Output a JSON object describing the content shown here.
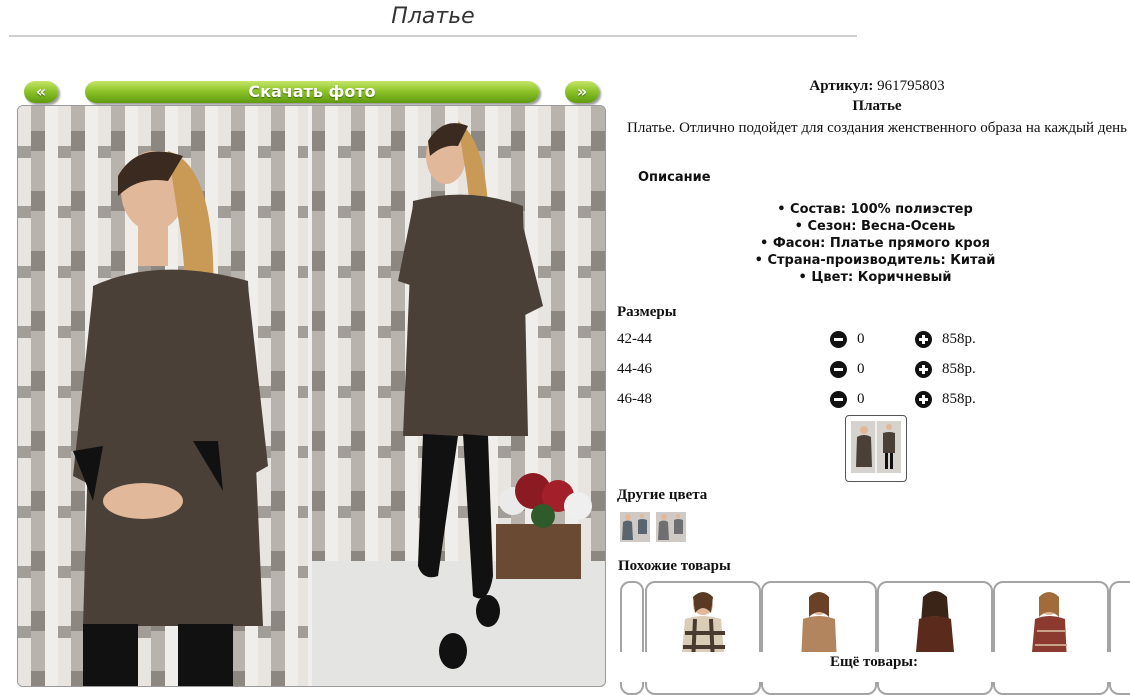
{
  "page": {
    "title": "Платье"
  },
  "gallery": {
    "prev_label": "«",
    "download_label": "Скачать фото",
    "next_label": "»"
  },
  "product": {
    "article_label": "Артикул:",
    "article_value": "961795803",
    "name": "Платье",
    "description": "Платье. Отлично подойдет для создания женственного образа на каждый день",
    "description_heading": "Описание",
    "features": [
      "• Состав: 100% полиэстер",
      "• Сезон: Весна-Осень",
      "• Фасон: Платье прямого кроя",
      "• Страна-производитель: Китай",
      "• Цвет: Коричневый"
    ]
  },
  "sizes": {
    "heading": "Размеры",
    "rows": [
      {
        "size": "42-44",
        "qty": "0",
        "price": "858р."
      },
      {
        "size": "44-46",
        "qty": "0",
        "price": "858р."
      },
      {
        "size": "46-48",
        "qty": "0",
        "price": "858р."
      }
    ]
  },
  "other_colors": {
    "heading": "Другие цвета"
  },
  "similar": {
    "heading": "Похожие товары",
    "more_label": "Ещё товары:"
  },
  "colors": {
    "accent_green_top": "#c6e56a",
    "accent_green_bottom": "#5f9a10",
    "dress_brown": "#4a4038"
  }
}
